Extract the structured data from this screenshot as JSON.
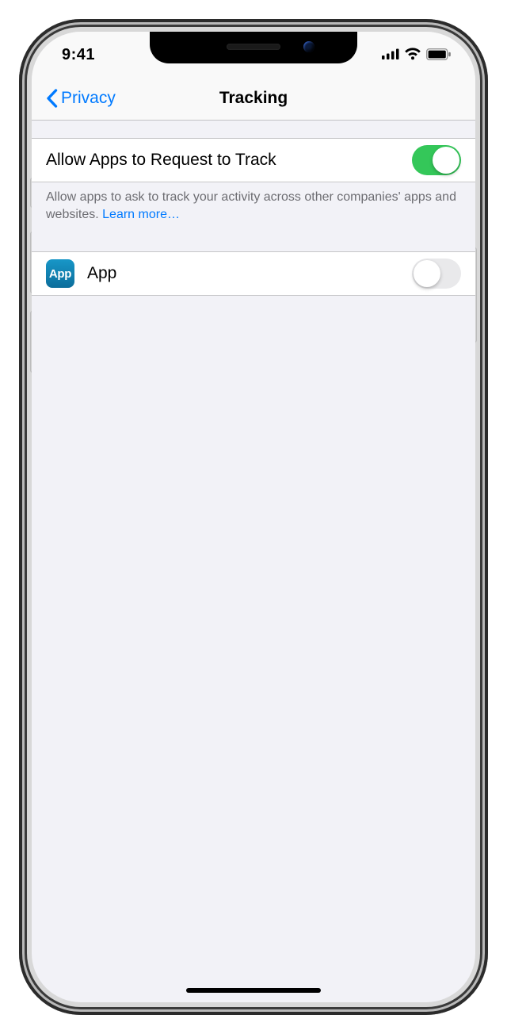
{
  "statusbar": {
    "time": "9:41"
  },
  "nav": {
    "back_label": "Privacy",
    "title": "Tracking"
  },
  "main_toggle": {
    "label": "Allow Apps to Request to Track",
    "on": true
  },
  "footer": {
    "text": "Allow apps to ask to track your activity across other companies' apps and websites. ",
    "link": "Learn more…"
  },
  "apps": [
    {
      "icon_text": "App",
      "name": "App",
      "on": false
    }
  ]
}
